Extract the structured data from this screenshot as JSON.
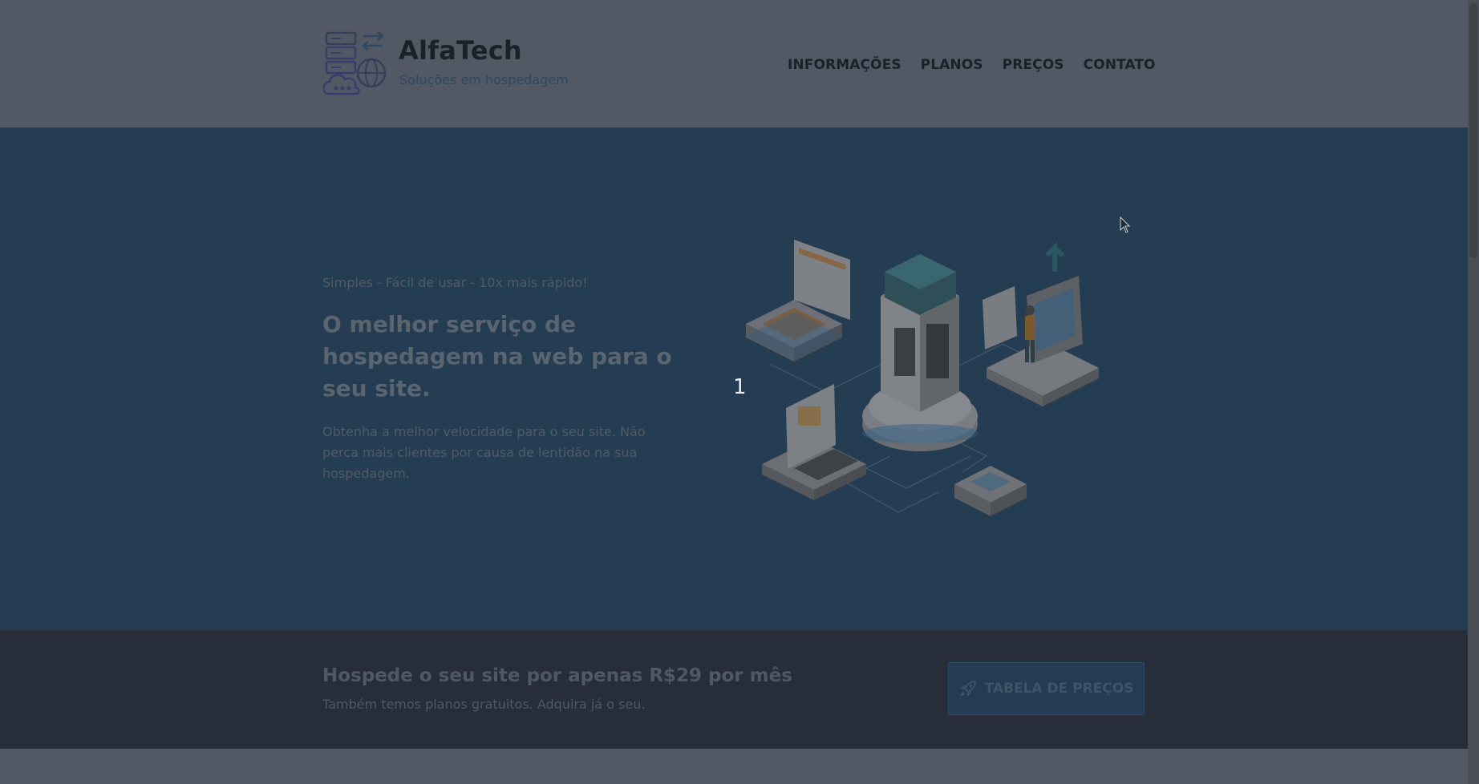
{
  "brand": {
    "name": "AlfaTech",
    "tagline": "Soluções em hospedagem",
    "logo_icon": "server-cloud-globe-icon"
  },
  "nav": {
    "items": [
      {
        "label": "INFORMAÇÕES"
      },
      {
        "label": "PLANOS"
      },
      {
        "label": "PREÇOS"
      },
      {
        "label": "CONTATO"
      }
    ]
  },
  "hero": {
    "eyebrow": "Simples - Fácil de usar - 10x mais rápido!",
    "title": "O melhor serviço de hospedagem na web para o seu site.",
    "description": "Obtenha a melhor velocidade para o seu site. Não perca mais clientes por causa de lentidão na sua hospedagem.",
    "slide_number": "1",
    "illustration": "isometric-server-network-illustration"
  },
  "cta": {
    "title": "Hospede o seu site por apenas R$29 por mês",
    "subtitle": "Também temos planos gratuitos. Adquira já o seu.",
    "button_label": "TABELA DE PREÇOS",
    "button_icon": "rocket-icon"
  },
  "colors": {
    "overlay_background": "#535964",
    "hero_background": "#253d52",
    "cta_background": "#272d39",
    "brand_text": "#1c2129",
    "accent": "#2d4860"
  }
}
